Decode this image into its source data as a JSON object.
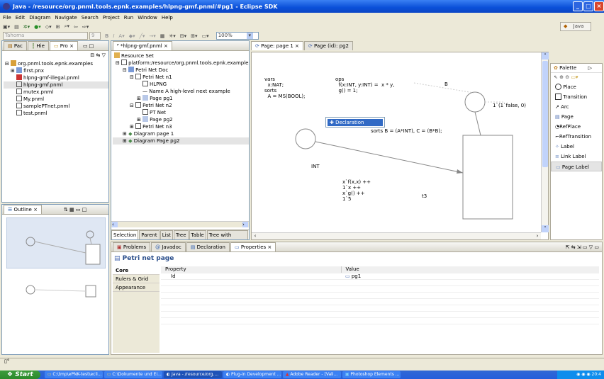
{
  "window": {
    "title": "Java - /resource/org.pnml.tools.epnk.examples/hlpng-gmf.pnml/#pg1 - Eclipse SDK"
  },
  "menu": [
    "File",
    "Edit",
    "Diagram",
    "Navigate",
    "Search",
    "Project",
    "Run",
    "Window",
    "Help"
  ],
  "toolbar": {
    "font": "Tahoma",
    "font_size": "9",
    "zoom": "100%",
    "perspective": "Java"
  },
  "left_view": {
    "tabs": [
      "Pac",
      "Hie",
      "Pro"
    ],
    "tree": [
      "org.pnml.tools.epnk.examples",
      "first.pnx",
      "hlpng-gmf-illegal.pnml",
      "hlpng-gmf.pnml",
      "mutex.pnml",
      "My.pnml",
      "samplePTnet.pnml",
      "test.pnml"
    ]
  },
  "outline": {
    "tab": "Outline"
  },
  "editor": {
    "tab": "*hlpng-gmf.pnml",
    "root": "Resource Set",
    "tree": [
      "platform:/resource/org.pnml.tools.epnk.examples",
      "Petri Net Doc",
      "Petri Net n1",
      "HLPNG",
      "Name A high-level next example",
      "Page pg1",
      "Petri Net n2",
      "PT Net",
      "Page pg2",
      "Petri Net n3",
      "Diagram page 1",
      "Diagram Page pg2"
    ],
    "bottom_tabs": [
      "Selection",
      "Parent",
      "List",
      "Tree",
      "Table",
      "Tree with Columns"
    ]
  },
  "diagram": {
    "tabs": [
      "Page: page 1",
      "Page (id): pg2"
    ],
    "vars": "vars\n  x:NAT;\nsorts\n  A = MS(BOOL);",
    "ops": "ops\n  f(x:INT, y:INT) =  x * y,\n  g() = 1;",
    "label_B": "B",
    "place_label": "1`(1`false, 0)",
    "declaration_menu": "Declaration",
    "sorts": "sorts B = (A*INT), C = (B*B);",
    "int_label": "INT",
    "arc_label": "x`f(x,x) ++\n1`x ++\nx`g() ++\n1`5",
    "t3": "t3"
  },
  "palette": {
    "title": "Palette",
    "items": [
      "Place",
      "Transition",
      "Arc",
      "Page",
      "RefPlace",
      "RefTransition",
      "Label",
      "Link Label",
      "Page Label"
    ]
  },
  "bottom": {
    "tabs": [
      "Problems",
      "Javadoc",
      "Declaration",
      "Properties"
    ],
    "title": "Petri net page",
    "side_tabs": [
      "Core",
      "Rulers & Grid",
      "Appearance"
    ],
    "col_property": "Property",
    "col_value": "Value",
    "row_property": "Id",
    "row_value": "pg1"
  },
  "taskbar": {
    "start": "Start",
    "tasks": [
      "C:\\tmp\\ePNK-test\\ecli...",
      "C:\\Dokumente und Ei...",
      "Java - /resource/org....",
      "Plug-in Development ...",
      "Adobe Reader - [Vali...",
      "Photoshop Elements ..."
    ],
    "clock": "20:4"
  }
}
